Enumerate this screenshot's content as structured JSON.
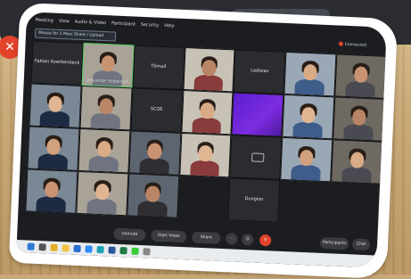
{
  "menu": [
    "Meeting",
    "View",
    "Audio & Video",
    "Participant",
    "Security",
    "Help"
  ],
  "address_text": "Mouse for 1 Maxi Share / Upload",
  "status": "Connected",
  "tiles": [
    {
      "label": "Fabian Koerbenbeck",
      "type": "name"
    },
    {
      "label": "Alexander Pinkernell",
      "type": "person",
      "active": true
    },
    {
      "label": "Tbmail",
      "type": "name"
    },
    {
      "label": "",
      "type": "person"
    },
    {
      "label": "Ladisiav",
      "type": "name"
    },
    {
      "label": "",
      "type": "person"
    },
    {
      "label": "",
      "type": "person"
    },
    {
      "label": "",
      "type": "person"
    },
    {
      "label": "",
      "type": "person"
    },
    {
      "label": "SCOE",
      "type": "name"
    },
    {
      "label": "",
      "type": "person"
    },
    {
      "label": "",
      "type": "purple"
    },
    {
      "label": "",
      "type": "person"
    },
    {
      "label": "",
      "type": "person"
    },
    {
      "label": "",
      "type": "person"
    },
    {
      "label": "",
      "type": "person"
    },
    {
      "label": "",
      "type": "person"
    },
    {
      "label": "",
      "type": "person"
    },
    {
      "label": "",
      "type": "icon"
    },
    {
      "label": "",
      "type": "person"
    },
    {
      "label": "",
      "type": "person"
    },
    {
      "label": "",
      "type": "person"
    },
    {
      "label": "",
      "type": "person"
    },
    {
      "label": "",
      "type": "person"
    },
    {
      "label": "Dungion",
      "type": "name"
    }
  ],
  "controls": {
    "unmute": "Unmute",
    "start_video": "Start Video",
    "share": "Share",
    "participants": "Participants",
    "chat": "Chat"
  },
  "colors": {
    "end_call": "#e3432b",
    "active_speaker": "#4fd061",
    "meeting_bg": "#1c1d20"
  }
}
